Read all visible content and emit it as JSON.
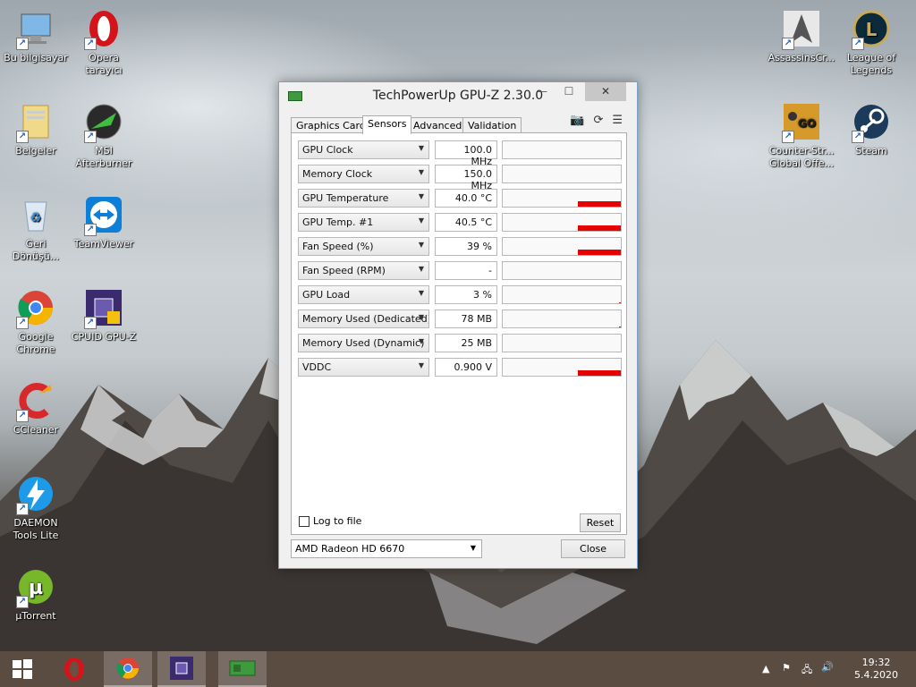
{
  "desktop": {
    "left_icons": [
      {
        "label": "Bu bilgisayar",
        "icon": "computer-icon"
      },
      {
        "label": "Opera tarayıcı",
        "icon": "opera-icon"
      },
      {
        "label": "Belgeler",
        "icon": "folder-icon"
      },
      {
        "label": "MSI Afterburner",
        "icon": "afterburner-icon"
      },
      {
        "label": "Geri Dönüşü...",
        "icon": "recycle-bin-icon"
      },
      {
        "label": "TeamViewer",
        "icon": "teamviewer-icon"
      },
      {
        "label": "Google Chrome",
        "icon": "chrome-icon"
      },
      {
        "label": "CPUID GPU-Z",
        "icon": "gpuz-icon"
      },
      {
        "label": "CCleaner",
        "icon": "ccleaner-icon"
      },
      {
        "label": "DAEMON Tools Lite",
        "icon": "daemon-tools-icon"
      },
      {
        "label": "µTorrent",
        "icon": "utorrent-icon"
      }
    ],
    "right_icons": [
      {
        "label": "AssassinsCr...",
        "icon": "assassins-creed-icon"
      },
      {
        "label": "League of Legends",
        "icon": "league-of-legends-icon"
      },
      {
        "label": "Counter-Str... Global Offe...",
        "icon": "csgo-icon"
      },
      {
        "label": "Steam",
        "icon": "steam-icon"
      }
    ]
  },
  "window": {
    "title": "TechPowerUp GPU-Z 2.30.0",
    "tabs": [
      "Graphics Card",
      "Sensors",
      "Advanced",
      "Validation"
    ],
    "active_tab": "Sensors",
    "toolbar_icons": [
      "camera-icon",
      "refresh-icon",
      "menu-icon"
    ],
    "sensors": [
      {
        "name": "GPU Clock",
        "value": "100.0 MHz",
        "level": 0
      },
      {
        "name": "Memory Clock",
        "value": "150.0 MHz",
        "level": 0
      },
      {
        "name": "GPU Temperature",
        "value": "40.0 °C",
        "level": 0.3
      },
      {
        "name": "GPU Temp. #1",
        "value": "40.5 °C",
        "level": 0.3
      },
      {
        "name": "Fan Speed (%)",
        "value": "39 %",
        "level": 0.39
      },
      {
        "name": "Fan Speed (RPM)",
        "value": "-",
        "level": 0
      },
      {
        "name": "GPU Load",
        "value": "3 %",
        "level": 0.03
      },
      {
        "name": "Memory Used (Dedicated)",
        "value": "78 MB",
        "level": 0.05
      },
      {
        "name": "Memory Used (Dynamic)",
        "value": "25 MB",
        "level": 0
      },
      {
        "name": "VDDC",
        "value": "0.900 V",
        "level": 0.3
      }
    ],
    "log_to_file_label": "Log to file",
    "log_to_file_checked": false,
    "reset_label": "Reset",
    "gpu_select": "AMD Radeon HD 6670",
    "close_label": "Close"
  },
  "taskbar": {
    "items": [
      "start-icon",
      "opera-icon",
      "chrome-icon",
      "gpuz-icon",
      "gpuz-window-icon"
    ],
    "time": "19:32",
    "date": "5.4.2020"
  },
  "colors": {
    "graph": "#e60000",
    "accent": "#1a63c8"
  }
}
